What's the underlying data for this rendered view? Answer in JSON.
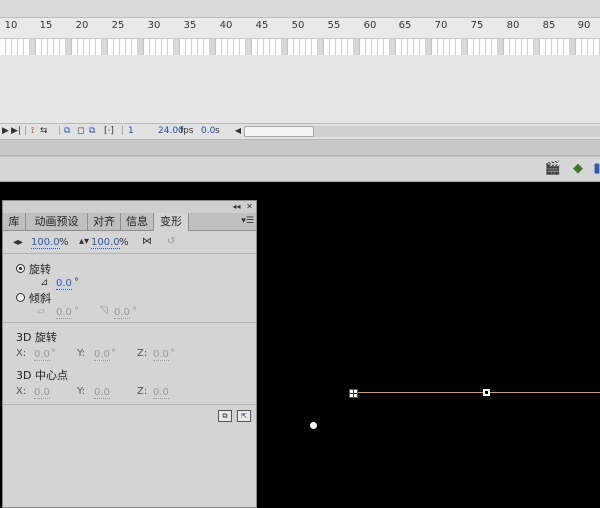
{
  "timeline": {
    "ruler_ticks": [
      "10",
      "15",
      "20",
      "25",
      "30",
      "35",
      "40",
      "45",
      "50",
      "55",
      "60",
      "65",
      "70",
      "75",
      "80",
      "85",
      "90"
    ],
    "controls": {
      "current_frame": "1",
      "frame_rate": "24.00",
      "fps_unit": "fps",
      "elapsed_time": "0.0",
      "time_unit": "s"
    }
  },
  "panel": {
    "tabs": [
      "库",
      "动画预设",
      "对齐",
      "信息",
      "变形"
    ],
    "active_tab": "变形",
    "scale": {
      "width": "100.0",
      "height": "100.0",
      "unit": "%"
    },
    "rotate": {
      "label": "旋转",
      "value": "0.0",
      "unit": "°"
    },
    "skew": {
      "label": "倾斜",
      "h_value": "0.0",
      "v_value": "0.0",
      "unit": "°"
    },
    "rotation3d": {
      "label": "3D 旋转",
      "x_label": "X:",
      "x": "0.0",
      "y_label": "Y:",
      "y": "0.0",
      "z_label": "Z:",
      "z": "0.0",
      "unit": "°"
    },
    "center3d": {
      "label": "3D 中心点",
      "x_label": "X:",
      "x": "0.0",
      "y_label": "Y:",
      "y": "0.0",
      "z_label": "Z:",
      "z": "0.0"
    }
  },
  "colors": {
    "stage": "#000000",
    "link_value": "#2a5bbf",
    "line": "#c9a06a"
  }
}
